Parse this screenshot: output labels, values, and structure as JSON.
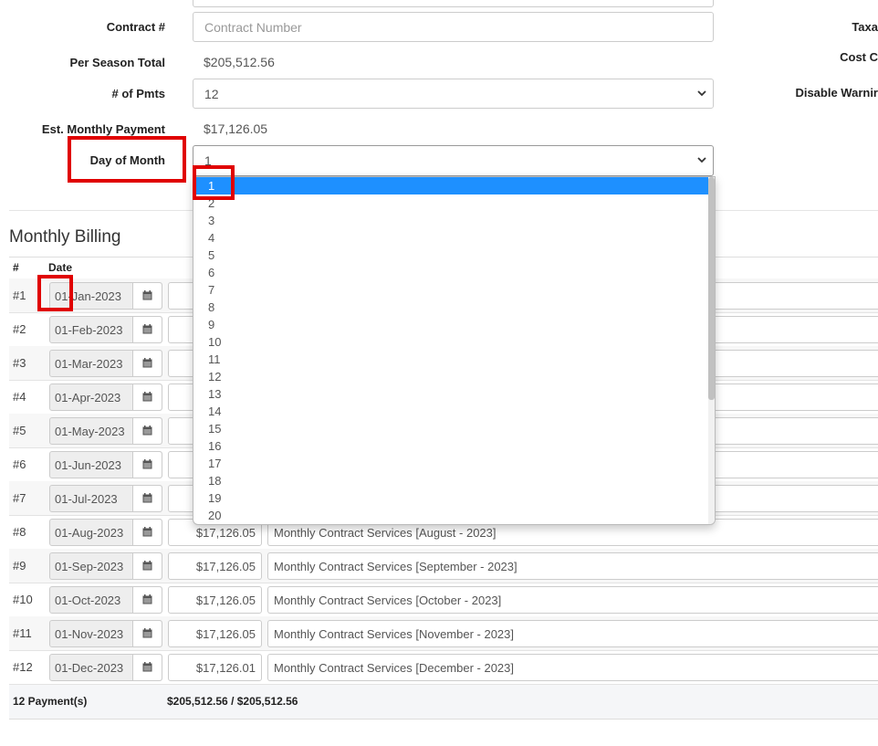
{
  "form": {
    "contract_label": "Contract #",
    "contract_placeholder": "Contract Number",
    "per_season_total_label": "Per Season Total",
    "per_season_total_value": "$205,512.56",
    "num_pmts_label": "# of Pmts",
    "num_pmts_value": "12",
    "est_monthly_label": "Est. Monthly Payment",
    "est_monthly_value": "$17,126.05",
    "day_of_month_label": "Day of Month",
    "day_of_month_value": "1"
  },
  "right_labels": {
    "taxable": "Taxa",
    "cost_center": "Cost C",
    "disable_warning": "Disable Warnir"
  },
  "billing": {
    "title": "Monthly Billing",
    "col_num": "#",
    "col_date": "Date",
    "rows": [
      {
        "num": "#1",
        "date": "01-Jan-2023",
        "amount": "",
        "desc": ""
      },
      {
        "num": "#2",
        "date": "01-Feb-2023",
        "amount": "",
        "desc": ""
      },
      {
        "num": "#3",
        "date": "01-Mar-2023",
        "amount": "",
        "desc": ""
      },
      {
        "num": "#4",
        "date": "01-Apr-2023",
        "amount": "",
        "desc": ""
      },
      {
        "num": "#5",
        "date": "01-May-2023",
        "amount": "",
        "desc": ""
      },
      {
        "num": "#6",
        "date": "01-Jun-2023",
        "amount": "",
        "desc": ""
      },
      {
        "num": "#7",
        "date": "01-Jul-2023",
        "amount": "",
        "desc": ""
      },
      {
        "num": "#8",
        "date": "01-Aug-2023",
        "amount": "$17,126.05",
        "desc": "Monthly Contract Services [August - 2023]"
      },
      {
        "num": "#9",
        "date": "01-Sep-2023",
        "amount": "$17,126.05",
        "desc": "Monthly Contract Services [September - 2023]"
      },
      {
        "num": "#10",
        "date": "01-Oct-2023",
        "amount": "$17,126.05",
        "desc": "Monthly Contract Services [October - 2023]"
      },
      {
        "num": "#11",
        "date": "01-Nov-2023",
        "amount": "$17,126.05",
        "desc": "Monthly Contract Services [November - 2023]"
      },
      {
        "num": "#12",
        "date": "01-Dec-2023",
        "amount": "$17,126.01",
        "desc": "Monthly Contract Services [December - 2023]"
      }
    ],
    "footer_count": "12 Payment(s)",
    "footer_total": "$205,512.56 / $205,512.56"
  },
  "dropdown": {
    "selected": "1",
    "options": [
      "1",
      "2",
      "3",
      "4",
      "5",
      "6",
      "7",
      "8",
      "9",
      "10",
      "11",
      "12",
      "13",
      "14",
      "15",
      "16",
      "17",
      "18",
      "19",
      "20"
    ]
  },
  "colors": {
    "highlight_red": "#e00000",
    "option_selected": "#1e90ff"
  }
}
